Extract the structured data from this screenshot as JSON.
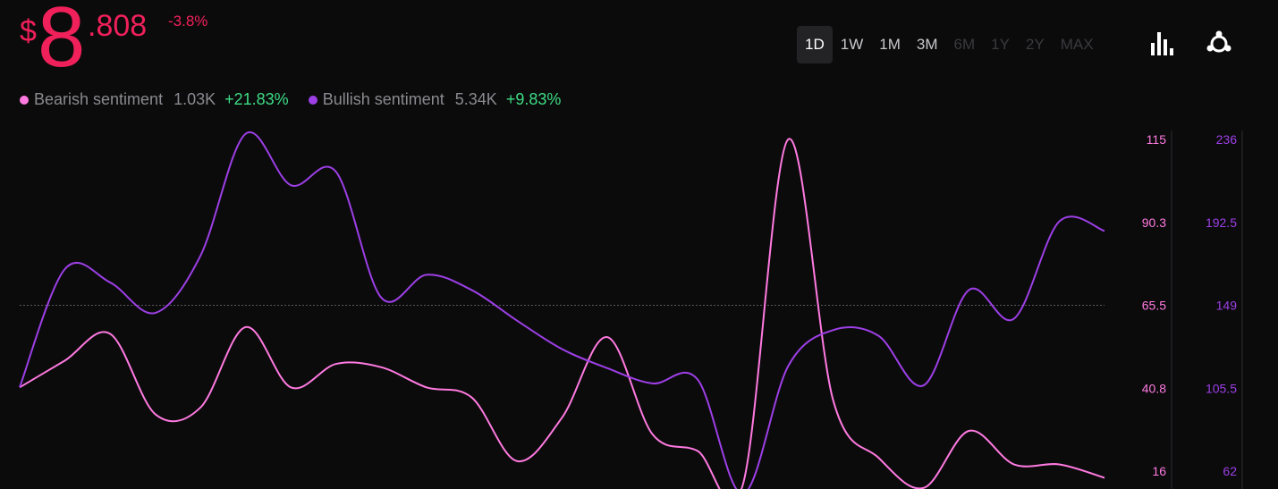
{
  "price": {
    "currency": "$",
    "integer": "8",
    "decimal": ".808",
    "change": "-3.8%",
    "color": "#f0205a"
  },
  "legend": [
    {
      "label": "Bearish sentiment",
      "value": "1.03K",
      "change": "+21.83%",
      "color": "#ff7ae0"
    },
    {
      "label": "Bullish sentiment",
      "value": "5.34K",
      "change": "+9.83%",
      "color": "#9d3fe6"
    }
  ],
  "ranges": [
    {
      "label": "1D",
      "state": "active"
    },
    {
      "label": "1W",
      "state": "enabled"
    },
    {
      "label": "1M",
      "state": "enabled"
    },
    {
      "label": "3M",
      "state": "enabled"
    },
    {
      "label": "6M",
      "state": "disabled"
    },
    {
      "label": "1Y",
      "state": "disabled"
    },
    {
      "label": "2Y",
      "state": "disabled"
    },
    {
      "label": "MAX",
      "state": "disabled"
    }
  ],
  "icons": {
    "chart_type": "bar-chart-icon",
    "network": "network-icon"
  },
  "chart_data": {
    "type": "line",
    "x_count": 25,
    "reference_line_value_left": 65.5,
    "series": [
      {
        "name": "Bearish sentiment",
        "axis": "left",
        "color": "#ff7ae0",
        "values": [
          41,
          49,
          57,
          33,
          35,
          59,
          41,
          48,
          47,
          41,
          38,
          19,
          32,
          56,
          27,
          22,
          12,
          115,
          37,
          20,
          11,
          28,
          18,
          18,
          14
        ]
      },
      {
        "name": "Bullish sentiment",
        "axis": "right",
        "color": "#9d3fe6",
        "values": [
          106,
          168,
          161,
          145,
          175,
          239,
          212,
          219,
          153,
          165,
          157,
          141,
          126,
          116,
          108,
          110,
          50,
          117,
          136,
          133,
          107,
          157,
          142,
          193,
          188
        ]
      }
    ],
    "left_axis": {
      "ticks": [
        "115",
        "90.3",
        "65.5",
        "40.8",
        "16"
      ],
      "range": [
        16,
        115
      ],
      "color": "#ff7ae0"
    },
    "right_axis": {
      "ticks": [
        "236",
        "192.5",
        "149",
        "105.5",
        "62"
      ],
      "range": [
        62,
        236
      ],
      "color": "#9d3fe6"
    },
    "grid": false
  }
}
